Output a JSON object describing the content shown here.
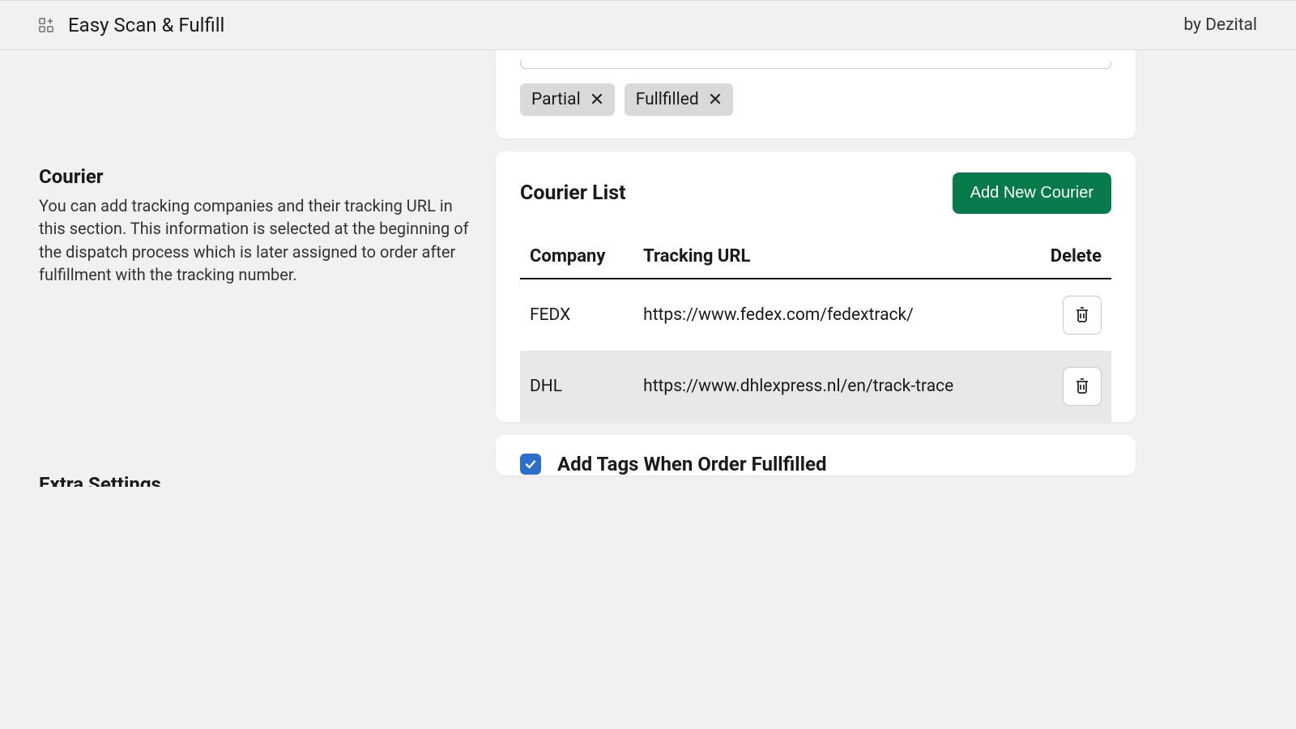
{
  "header": {
    "title": "Easy Scan & Fulfill",
    "credit": "by Dezital"
  },
  "tags": {
    "items": [
      {
        "label": "Partial"
      },
      {
        "label": "Fullfilled"
      }
    ]
  },
  "courier_section": {
    "title": "Courier",
    "description": "You can add tracking companies and their tracking URL in this section. This information is selected at the beginning of the dispatch process which is later assigned to order after fulfillment with the tracking number."
  },
  "courier_list": {
    "title": "Courier List",
    "add_button": "Add New Courier",
    "columns": {
      "company": "Company",
      "tracking_url": "Tracking URL",
      "delete": "Delete"
    },
    "rows": [
      {
        "company": "FEDX",
        "url": "https://www.fedex.com/fedextrack/"
      },
      {
        "company": "DHL",
        "url": "https://www.dhlexpress.nl/en/track-trace"
      }
    ]
  },
  "extra": {
    "section_title": "Extra Settings",
    "checkbox_label": "Add Tags When Order Fullfilled",
    "checked": true
  }
}
